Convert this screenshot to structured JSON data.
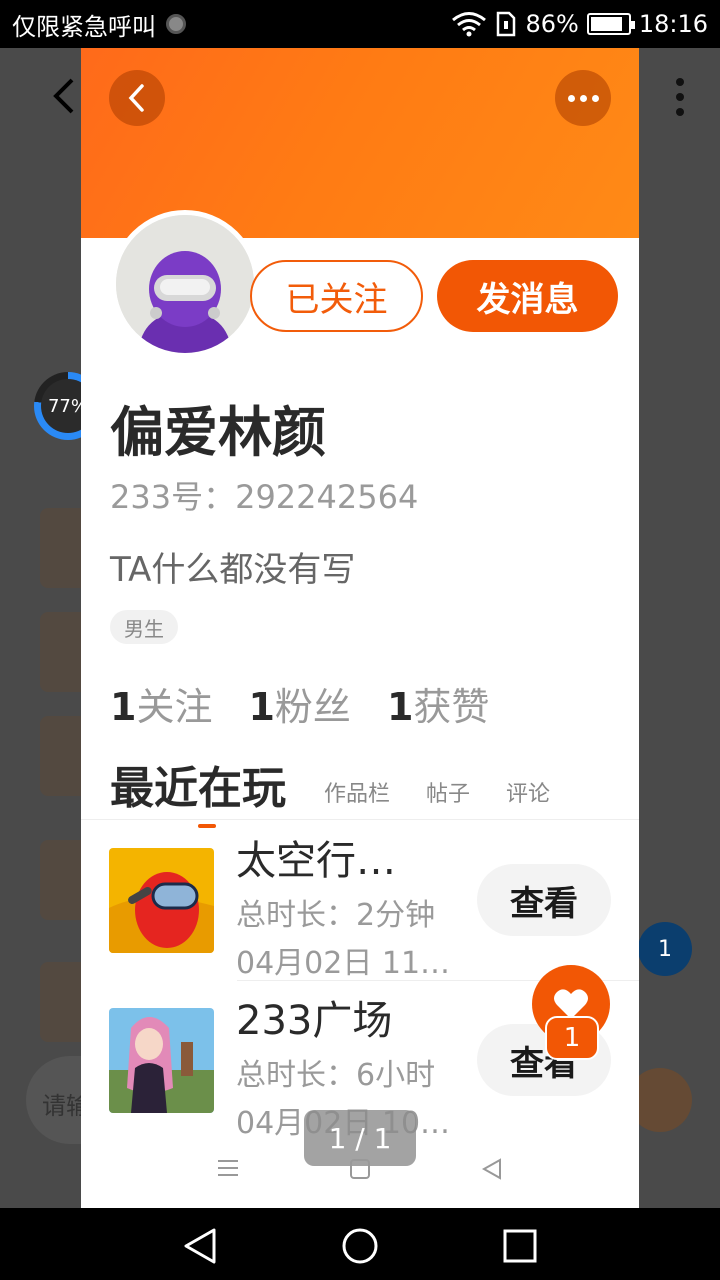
{
  "status_bar": {
    "carrier": "仅限紧急呼叫",
    "battery": "86%",
    "battery_level": 0.86,
    "time": "18:16"
  },
  "background": {
    "progress_label": "77%",
    "progress_level": 0.77,
    "badge_count": "1",
    "input_placeholder": "请输"
  },
  "header": {
    "back_icon": "chevron-left-icon",
    "more_icon": "more-dots-icon"
  },
  "profile": {
    "follow_button": "已关注",
    "message_button": "发消息",
    "username": "偏爱林颜",
    "user_id": "233号：292242564",
    "bio": "TA什么都没有写",
    "gender_tag": "男生",
    "stats": [
      {
        "num": "1",
        "label": "关注"
      },
      {
        "num": "1",
        "label": "粉丝"
      },
      {
        "num": "1",
        "label": "获赞"
      }
    ]
  },
  "tabs": {
    "active": "最近在玩",
    "others": [
      "作品栏",
      "帖子",
      "评论"
    ]
  },
  "games": [
    {
      "name": "太空行…",
      "playtime": "总时长：2分钟",
      "date": "04月02日 11…",
      "action": "查看"
    },
    {
      "name": "233广场",
      "playtime": "总时长：6小时",
      "date": "04月02日 10…",
      "action": "查看"
    }
  ],
  "like": {
    "icon": "heart-icon",
    "count": "1"
  },
  "pager": {
    "label": "1 / 1"
  },
  "mini_nav": {
    "menu_icon": "menu-icon",
    "home_icon": "square-icon",
    "back_icon": "triangle-back-icon"
  },
  "colors": {
    "accent": "#f25705",
    "header_gradient_start": "#ff6a1a",
    "header_gradient_end": "#ff8a16"
  }
}
